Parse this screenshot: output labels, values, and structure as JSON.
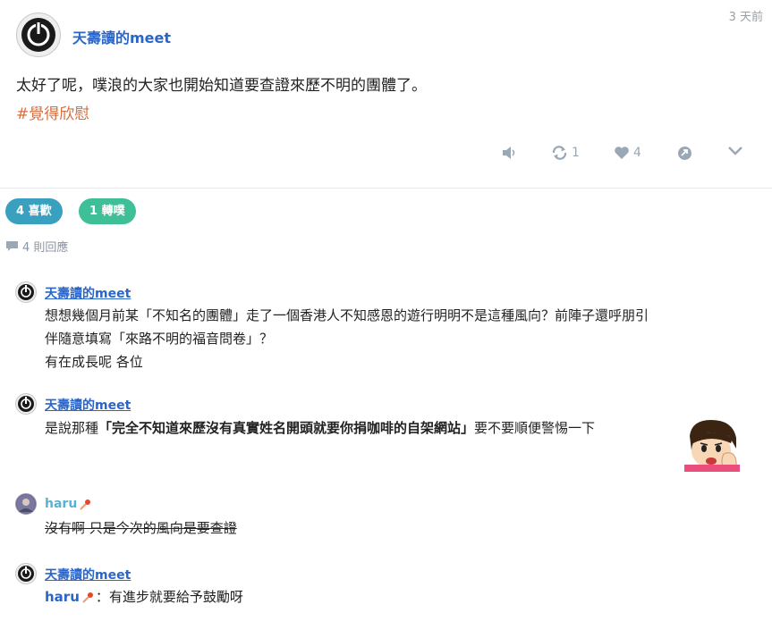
{
  "post": {
    "author": "天壽讀的meet",
    "timestamp": "3 天前",
    "text": "太好了呢，噗浪的大家也開始知道要查證來歷不明的團體了。",
    "hashtag": "#覺得欣慰"
  },
  "actions": {
    "mute_icon": "speaker-icon",
    "replurk_count": "1",
    "like_count": "4",
    "share_icon": "share-icon",
    "more_icon": "chevron-down-icon"
  },
  "badges": {
    "likes": "4 喜歡",
    "replurks": "1 轉噗"
  },
  "responses_header": "4 則回應",
  "responses": [
    {
      "author": "天壽讀的meet",
      "line1": "想想幾個月前某「不知名的團體」走了一個香港人不知感恩的遊行明明不是這種風向？前陣子還呼朋引",
      "line2": "伴隨意填寫「來路不明的福音問卷」？",
      "line3": "有在成長呢 各位"
    },
    {
      "author": "天壽讀的meet",
      "pre": "是說那種",
      "bold": "「完全不知道來歷沒有真實姓名開頭就要你捐咖啡的自架網站」",
      "post": "要不要順便警惕一下"
    },
    {
      "author": "haru",
      "text": "沒有啊 只是今次的風向是要查證"
    },
    {
      "author": "天壽讀的meet",
      "mention": "haru",
      "text": "：有進步就要給予鼓勵呀"
    }
  ],
  "colors": {
    "author_link": "#2a66c9",
    "hashtag": "#d66f3f",
    "badge_likes": "#3aa0bf",
    "badge_replurks": "#3fbf97",
    "haru_name": "#55b3d6",
    "icon_gray": "#9aa7b5"
  }
}
